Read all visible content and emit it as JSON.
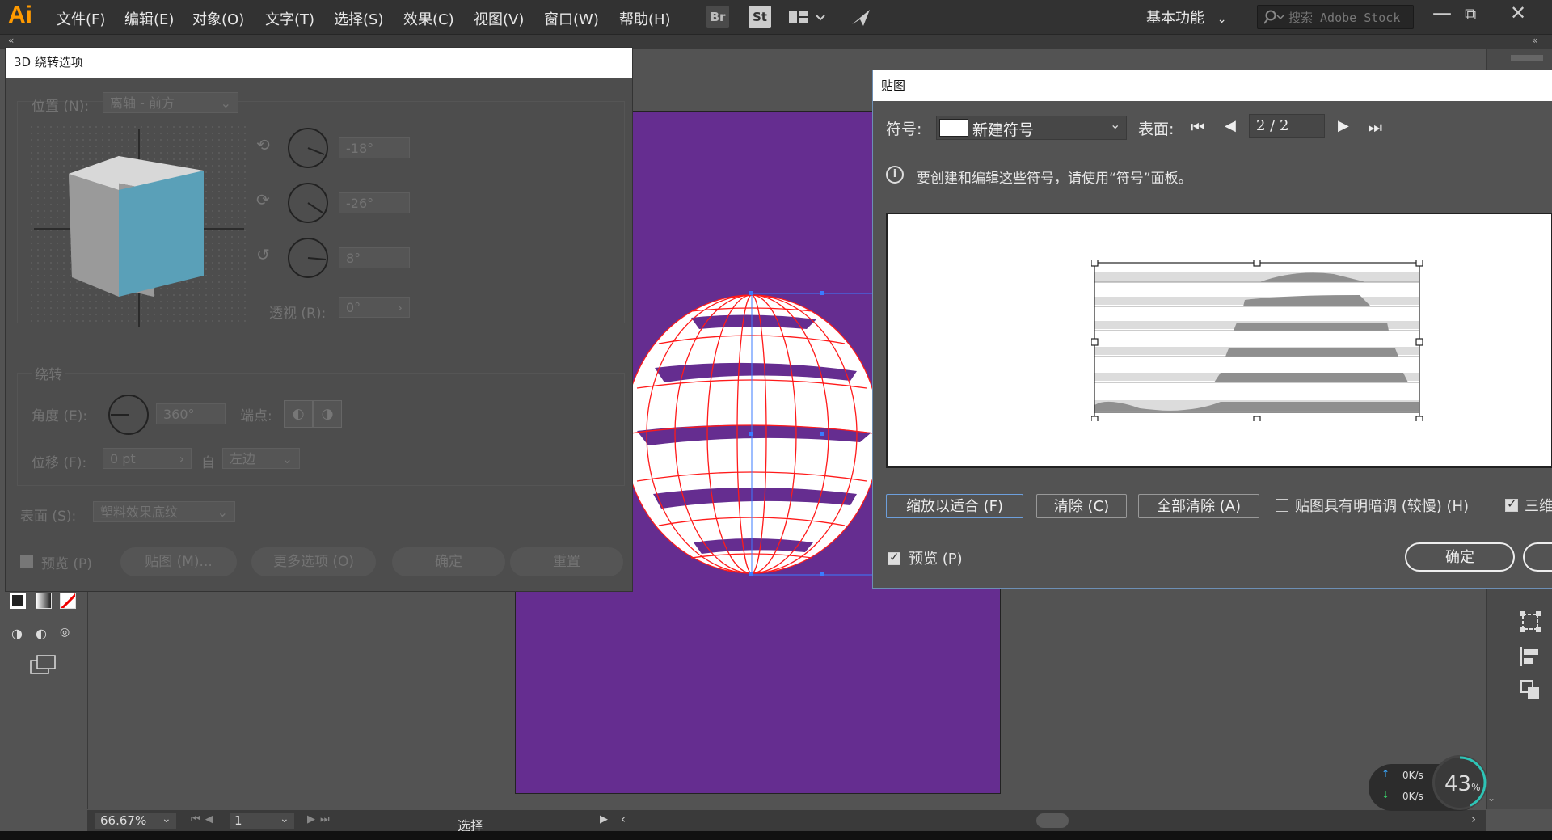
{
  "app": {
    "logo": "Ai"
  },
  "menu": [
    "文件(F)",
    "编辑(E)",
    "对象(O)",
    "文字(T)",
    "选择(S)",
    "效果(C)",
    "视图(V)",
    "窗口(W)",
    "帮助(H)"
  ],
  "toolbar_buttons": {
    "bridge": "Br",
    "stock": "St"
  },
  "workspace": {
    "label": "基本功能"
  },
  "search": {
    "placeholder": "搜索 Adobe Stock"
  },
  "dialog3d": {
    "title": "3D 绕转选项",
    "position_label": "位置 (N):",
    "position_value": "离轴 - 前方",
    "rot_x": "-18°",
    "rot_y": "-26°",
    "rot_z": "8°",
    "perspective_label": "透视 (R):",
    "perspective_value": "0°",
    "revolve_section": "绕转",
    "angle_label": "角度 (E):",
    "angle_value": "360°",
    "cap_label": "端点:",
    "offset_label": "位移 (F):",
    "offset_value": "0 pt",
    "from_label": "自",
    "from_value": "左边",
    "surface_label": "表面 (S):",
    "surface_value": "塑料效果底纹",
    "preview_label": "预览 (P)",
    "map_button": "贴图 (M)...",
    "more_button": "更多选项 (O)",
    "ok_button": "确定",
    "reset_button": "重置"
  },
  "dialogmap": {
    "title": "贴图",
    "symbol_label": "符号:",
    "symbol_value": "新建符号",
    "surface_label": "表面:",
    "surface_page": "2 / 2",
    "info_text": "要创建和编辑这些符号，请使用“符号”面板。",
    "scale_button": "缩放以适合 (F)",
    "clear_button": "清除 (C)",
    "clear_all_button": "全部清除 (A)",
    "shade_label": "贴图具有明暗调 (较慢) (H)",
    "invisible_label": "三维",
    "preview_label": "预览 (P)",
    "ok_button": "确定"
  },
  "status": {
    "zoom": "66.67%",
    "page": "1",
    "tool": "选择"
  },
  "netmeter": {
    "up": "0K/s",
    "down": "0K/s",
    "percent": "43",
    "percent_unit": "%"
  },
  "colors": {
    "artboard": "#652d90",
    "cube_front": "#5aa0b8",
    "wireframe": "#ff1a1a",
    "accent": "#ff9a00"
  }
}
